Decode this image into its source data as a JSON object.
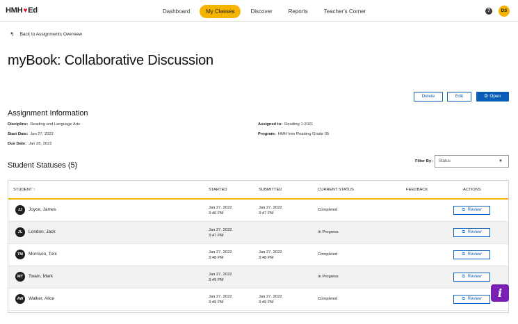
{
  "brand": {
    "logo_left": "HMH",
    "logo_right": "Ed",
    "logo_heart": "♥"
  },
  "nav": {
    "items": [
      {
        "label": "Dashboard"
      },
      {
        "label": "My Classes",
        "active": true
      },
      {
        "label": "Discover"
      },
      {
        "label": "Reports"
      },
      {
        "label": "Teacher's Corner"
      }
    ]
  },
  "header": {
    "help_icon": "?",
    "user_initials": "DS"
  },
  "back_link": {
    "icon": "↰",
    "label": "Back to Assignments Overview"
  },
  "page_title": "myBook: Collaborative Discussion",
  "actions": {
    "delete": "Delete",
    "edit": "Edit",
    "open": "Open",
    "open_icon": "⧉"
  },
  "assignment_info": {
    "title": "Assignment Information",
    "discipline_label": "Discipline:",
    "discipline": "Reading and Language Arts",
    "start_label": "Start Date:",
    "start": "Jan 27, 2022",
    "due_label": "Due Date:",
    "due": "Jan 28, 2022",
    "assigned_label": "Assigned to:",
    "assigned": "Reading 1-2021",
    "program_label": "Program:",
    "program": "HMH Into Reading Grade 05"
  },
  "statuses": {
    "title": "Student Statuses (5)",
    "filter_label": "Filter By:",
    "filter_value": "Status",
    "filter_caret": "▼"
  },
  "table": {
    "headers": {
      "student": "STUDENT ↑",
      "started": "STARTED",
      "submitted": "SUBMITTED",
      "status": "CURRENT STATUS",
      "feedback": "FEEDBACK",
      "actions": "ACTIONS"
    },
    "review_label": "Review",
    "review_icon": "⧉",
    "rows": [
      {
        "initials": "JJ",
        "name": "Joyce, James",
        "started_date": "Jan 27, 2022",
        "started_time": "3:46 PM",
        "submitted_date": "Jan 27, 2022",
        "submitted_time": "3:47 PM",
        "status": "Completed"
      },
      {
        "initials": "JL",
        "name": "London, Jack",
        "started_date": "Jan 27, 2022",
        "started_time": "3:47 PM",
        "submitted_date": "",
        "submitted_time": "",
        "status": "In Progress"
      },
      {
        "initials": "TM",
        "name": "Morrison, Toni",
        "started_date": "Jan 27, 2022",
        "started_time": "3:48 PM",
        "submitted_date": "Jan 27, 2022",
        "submitted_time": "3:48 PM",
        "status": "Completed"
      },
      {
        "initials": "MT",
        "name": "Twain, Mark",
        "started_date": "Jan 27, 2022",
        "started_time": "3:49 PM",
        "submitted_date": "",
        "submitted_time": "",
        "status": "In Progress"
      },
      {
        "initials": "AW",
        "name": "Walker, Alice",
        "started_date": "Jan 27, 2022",
        "started_time": "3:49 PM",
        "submitted_date": "Jan 27, 2022",
        "submitted_time": "3:49 PM",
        "status": "Completed"
      }
    ]
  },
  "info_fab": {
    "label": "i"
  },
  "colors": {
    "accent": "#f5b400",
    "primary": "#0b5eb8",
    "fab": "#7a1fb4"
  }
}
